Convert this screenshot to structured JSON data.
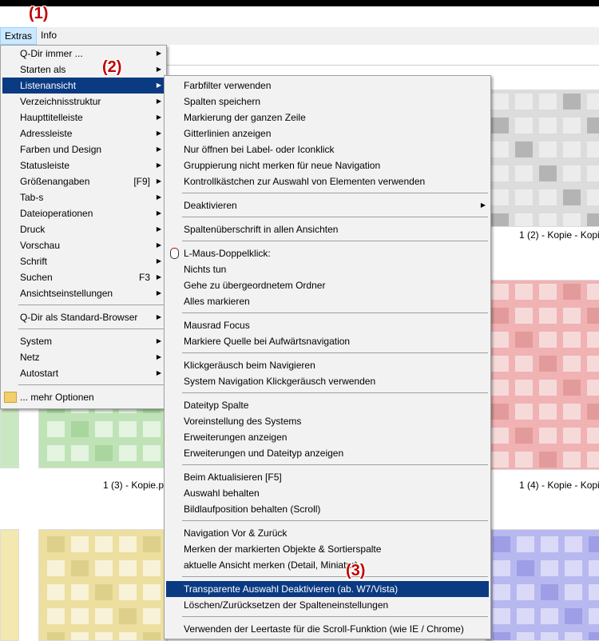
{
  "menubar": {
    "extras": "Extras",
    "info": "Info"
  },
  "annotations": {
    "a1": "(1)",
    "a2": "(2)",
    "a3": "(3)"
  },
  "main_menu": [
    {
      "label": "Q-Dir immer ...",
      "arrow": true
    },
    {
      "label": "Starten als",
      "arrow": true
    },
    {
      "label": "Listenansicht",
      "arrow": true,
      "highlighted": true
    },
    {
      "label": "Verzeichnisstruktur",
      "arrow": true
    },
    {
      "label": "Haupttitelleiste",
      "arrow": true
    },
    {
      "label": "Adressleiste",
      "arrow": true
    },
    {
      "label": "Farben und Design",
      "arrow": true
    },
    {
      "label": "Statusleiste",
      "arrow": true
    },
    {
      "label": "Größenangaben",
      "shortcut": "[F9]",
      "arrow": true
    },
    {
      "label": "Tab-s",
      "arrow": true
    },
    {
      "label": "Dateioperationen",
      "arrow": true
    },
    {
      "label": "Druck",
      "arrow": true
    },
    {
      "label": "Vorschau",
      "arrow": true
    },
    {
      "label": "Schrift",
      "arrow": true
    },
    {
      "label": "Suchen",
      "shortcut": "F3",
      "arrow": true
    },
    {
      "label": "Ansichtseinstellungen",
      "arrow": true
    },
    {
      "sep": true
    },
    {
      "label": "Q-Dir als Standard-Browser",
      "arrow": true
    },
    {
      "sep": true
    },
    {
      "label": "System",
      "arrow": true
    },
    {
      "label": "Netz",
      "arrow": true
    },
    {
      "label": "Autostart",
      "arrow": true
    },
    {
      "sep": true
    },
    {
      "label": "... mehr Optionen",
      "icon": "folder-icon"
    }
  ],
  "sub_menu": [
    {
      "label": "Farbfilter verwenden"
    },
    {
      "label": "Spalten speichern"
    },
    {
      "label": "Markierung der ganzen Zeile"
    },
    {
      "label": "Gitterlinien anzeigen"
    },
    {
      "label": "Nur öffnen bei Label- oder Iconklick"
    },
    {
      "label": "Gruppierung nicht merken für neue Navigation"
    },
    {
      "label": "Kontrollkästchen zur Auswahl von Elementen verwenden"
    },
    {
      "sep": true
    },
    {
      "label": "Deaktivieren",
      "arrow": true
    },
    {
      "sep": true
    },
    {
      "label": "Spaltenüberschrift in allen Ansichten"
    },
    {
      "sep": true
    },
    {
      "label": "L-Maus-Doppelklick:",
      "icon": "mouse-icon"
    },
    {
      "label": "Nichts tun"
    },
    {
      "label": "Gehe zu übergeordnetem Ordner"
    },
    {
      "label": "Alles markieren"
    },
    {
      "sep": true
    },
    {
      "label": "Mausrad Focus"
    },
    {
      "label": "Markiere Quelle bei Aufwärtsnavigation"
    },
    {
      "sep": true
    },
    {
      "label": "Klickgeräusch beim Navigieren"
    },
    {
      "label": "System Navigation Klickgeräusch verwenden"
    },
    {
      "sep": true
    },
    {
      "label": "Dateityp Spalte"
    },
    {
      "label": "Voreinstellung des Systems"
    },
    {
      "label": "Erweiterungen anzeigen"
    },
    {
      "label": "Erweiterungen und Dateityp anzeigen"
    },
    {
      "sep": true
    },
    {
      "label": "Beim Aktualisieren [F5]"
    },
    {
      "label": "Auswahl behalten"
    },
    {
      "label": "Bildlaufposition behalten (Scroll)"
    },
    {
      "sep": true
    },
    {
      "label": "Navigation Vor & Zurück"
    },
    {
      "label": "Merken der markierten Objekte & Sortierspalte"
    },
    {
      "label": "aktuelle Ansicht merken (Detail, Miniatur)"
    },
    {
      "sep": true
    },
    {
      "label": "Transparente Auswahl Deaktivieren (ab. W7/Vista)",
      "highlighted": true
    },
    {
      "label": "Löschen/Zurücksetzen der Spalteneinstellungen"
    },
    {
      "sep": true
    },
    {
      "label": "Verwenden der Leertaste für die Scroll-Funktion (wie IE / Chrome)"
    }
  ],
  "captions": {
    "c1": "1 (2) - Kopie - Kopi",
    "c2": "1 (3) - Kopie.p",
    "c3": "1 (4) - Kopie - Kopi"
  },
  "colors": {
    "highlight": "#0a3a82",
    "annotation": "#c00000"
  }
}
